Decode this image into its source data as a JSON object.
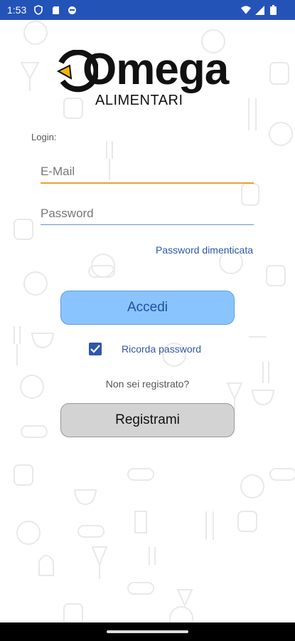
{
  "status_bar": {
    "time": "1:53",
    "left_icons": [
      "shield-icon",
      "sim-card-icon",
      "face-icon"
    ],
    "right_icons": [
      "wifi-icon",
      "signal-icon",
      "battery-icon"
    ]
  },
  "logo": {
    "brand": "Omega",
    "subtitle": "ALIMENTARI",
    "accent_color": "#f5b400"
  },
  "form": {
    "section_label": "Login:",
    "email_placeholder": "E-Mail",
    "email_value": "",
    "password_placeholder": "Password",
    "password_value": "",
    "forgot_password": "Password dimenticata",
    "login_button": "Accedi",
    "remember_password": "Ricorda password",
    "remember_checked": true,
    "not_registered": "Non sei registrato?",
    "register_button": "Registrami"
  },
  "colors": {
    "status_bar": "#2453b8",
    "primary_button": "#8ac4ff",
    "link": "#2f57a8",
    "email_underline": "#e8a32d"
  }
}
